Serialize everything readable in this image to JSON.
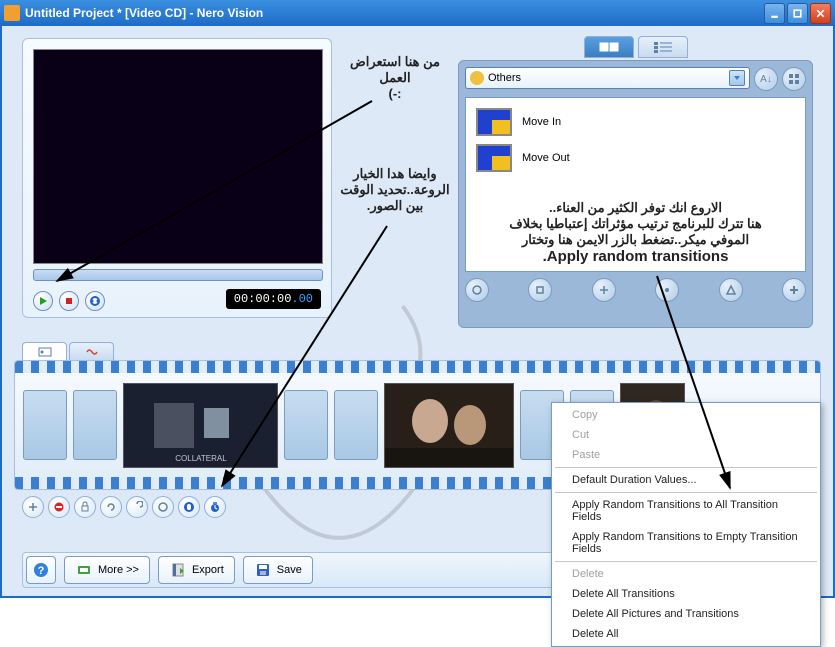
{
  "window": {
    "title": "Untitled Project * [Video CD] - Nero Vision"
  },
  "preview": {
    "timecode_main": "00:00:00",
    "timecode_frames": ".00"
  },
  "transitions": {
    "combo_label": "Others",
    "items": [
      {
        "label": "Move In"
      },
      {
        "label": "Move Out"
      }
    ]
  },
  "annotations": {
    "ar1": "من هنا استعراض العمل",
    "ar1b": ":-)",
    "ar2": "وايضا هدا الخيار الروعة..تحديد الوقت بين الصور.",
    "ar3_l1": "الاروع انك توفر الكثير من العناء..",
    "ar3_l2": "هنا تترك للبرنامج ترتيب مؤثراتك إعتباطيا بخلاف",
    "ar3_l3": "الموفي ميكر..تضغط بالزر الايمن هنا وتختار",
    "ar3_en": "Apply random transitions."
  },
  "bottom": {
    "more": "More >>",
    "export": "Export",
    "save": "Save"
  },
  "context_menu": {
    "copy": "Copy",
    "cut": "Cut",
    "paste": "Paste",
    "default_duration": "Default Duration Values...",
    "apply_all": "Apply Random Transitions to All Transition Fields",
    "apply_empty": "Apply Random Transitions to Empty Transition Fields",
    "delete": "Delete",
    "delete_trans": "Delete All Transitions",
    "delete_pics": "Delete All Pictures and Transitions",
    "delete_all": "Delete All"
  }
}
